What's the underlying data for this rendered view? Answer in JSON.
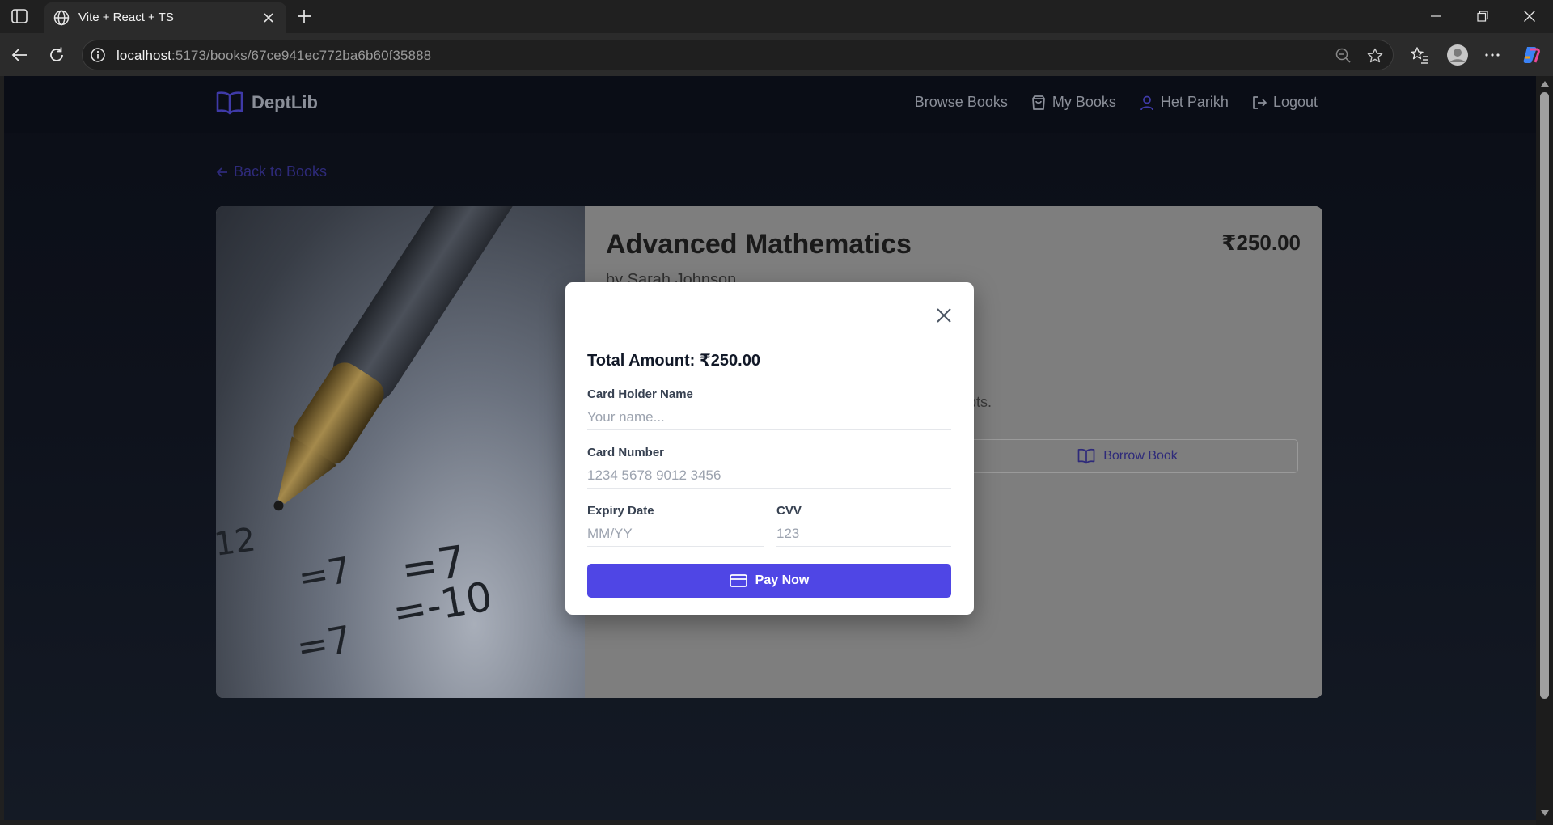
{
  "browser": {
    "tab_title": "Vite + React + TS",
    "url_host": "localhost",
    "url_rest": ":5173/books/67ce941ec772ba6b60f35888"
  },
  "navbar": {
    "brand": "DeptLib",
    "links": [
      {
        "label": "Browse Books",
        "icon": "none"
      },
      {
        "label": "My Books",
        "icon": "bag-icon"
      },
      {
        "label": "Het Parikh",
        "icon": "user-icon"
      },
      {
        "label": "Logout",
        "icon": "logout-icon"
      }
    ]
  },
  "page": {
    "back_link": "Back to Books"
  },
  "book": {
    "title": "Advanced Mathematics",
    "author": "by Sarah Johnson",
    "price": "₹250.00",
    "description_fragment": "epts.",
    "borrow_label": "Borrow Book"
  },
  "payment_modal": {
    "total": "Total Amount: ₹250.00",
    "card_holder_label": "Card Holder Name",
    "card_holder_placeholder": "Your name...",
    "card_number_label": "Card Number",
    "card_number_placeholder": "1234 5678 9012 3456",
    "expiry_label": "Expiry Date",
    "expiry_placeholder": "MM/YY",
    "cvv_label": "CVV",
    "cvv_placeholder": "123",
    "pay_label": "Pay Now"
  },
  "colors": {
    "accent": "#4f46e5",
    "page_bg": "#0e121c"
  }
}
